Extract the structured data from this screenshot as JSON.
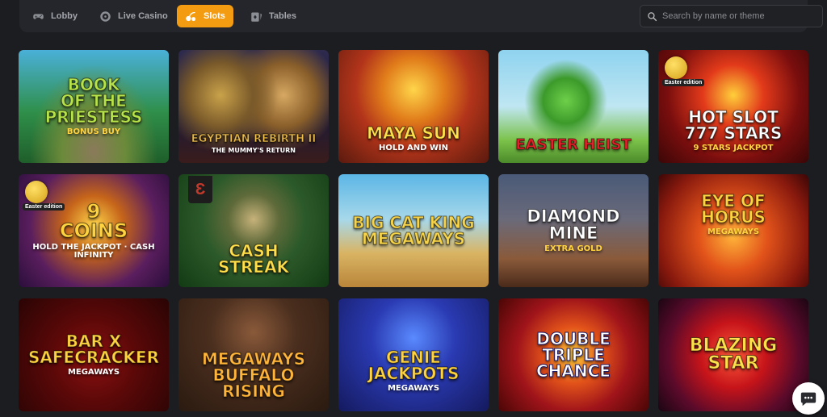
{
  "nav": {
    "tabs": [
      {
        "label": "Lobby",
        "icon": "gamepad-icon",
        "active": false
      },
      {
        "label": "Live Casino",
        "icon": "roulette-icon",
        "active": false
      },
      {
        "label": "Slots",
        "icon": "cherries-icon",
        "active": true
      },
      {
        "label": "Tables",
        "icon": "cards-icon",
        "active": false
      }
    ],
    "search_placeholder": "Search by name or theme"
  },
  "colors": {
    "background": "#1c1d21",
    "accent": "#f39c12"
  },
  "games": [
    {
      "title": "Book\nof the\nPriestess",
      "subtitle": "Bonus Buy"
    },
    {
      "title": "Egyptian Rebirth II",
      "subtitle": "The Mummy's Return"
    },
    {
      "title": "Maya Sun",
      "subtitle": "Hold and Win"
    },
    {
      "title": "Easter Heist",
      "subtitle": ""
    },
    {
      "title": "Hot Slot\n777 Stars",
      "subtitle": "9 Stars Jackpot",
      "badge": "Easter edition"
    },
    {
      "title": "9\nCoins",
      "subtitle": "Hold the Jackpot · Cash Infinity",
      "badge": "Easter edition"
    },
    {
      "title": "Cash\nStreak",
      "subtitle": ""
    },
    {
      "title": "Big Cat King\nMegaways",
      "subtitle": ""
    },
    {
      "title": "Diamond\nMine",
      "subtitle": "Extra Gold"
    },
    {
      "title": "Eye of\nHorus",
      "subtitle": "Megaways"
    },
    {
      "title": "Bar X\nSafecracker",
      "subtitle": "Megaways"
    },
    {
      "title": "Megaways\nBuffalo\nRising",
      "subtitle": ""
    },
    {
      "title": "Genie\nJackpots",
      "subtitle": "Megaways"
    },
    {
      "title": "Double\nTriple\nChance",
      "subtitle": ""
    },
    {
      "title": "Blazing Star",
      "subtitle": ""
    }
  ]
}
